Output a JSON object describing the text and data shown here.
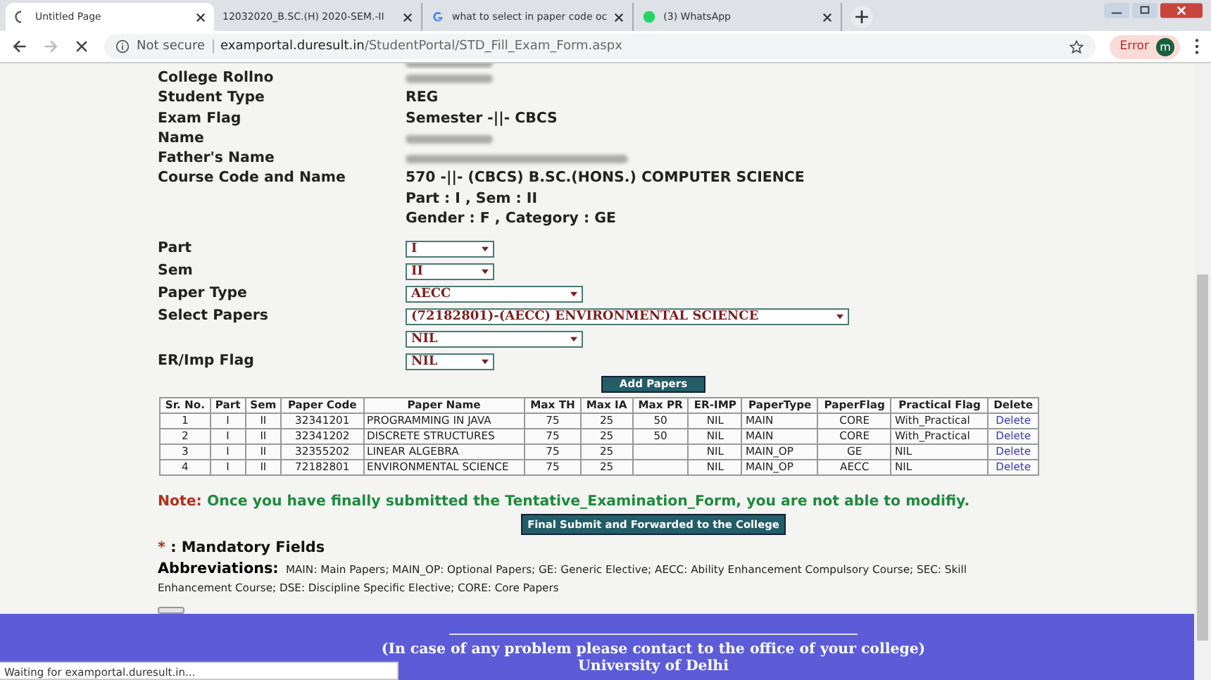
{
  "browser": {
    "tabs": [
      {
        "title": "Untitled Page",
        "kind": "loading",
        "selected": true
      },
      {
        "title": "12032020_B.SC.(H) 2020-SEM.-II",
        "kind": "plain",
        "selected": false
      },
      {
        "title": "what to select in paper code oc",
        "kind": "google",
        "selected": false
      },
      {
        "title": "(3) WhatsApp",
        "kind": "whatsapp",
        "selected": false
      }
    ],
    "security": "Not secure",
    "url_host": "examportal.duresult.in",
    "url_path": "/StudentPortal/STD_Fill_Exam_Form.aspx",
    "error_label": "Error",
    "profile_initial": "m"
  },
  "details": [
    {
      "label": "College Rollno",
      "kind": "blurred"
    },
    {
      "label": "Student Type",
      "kind": "text",
      "lines": [
        "REG"
      ]
    },
    {
      "label": "Exam Flag",
      "kind": "text",
      "lines": [
        "Semester -||- CBCS"
      ]
    },
    {
      "label": "Name",
      "kind": "blurred"
    },
    {
      "label": "Father's Name",
      "kind": "blurred"
    },
    {
      "label": "Course Code and Name",
      "kind": "text",
      "lines": [
        "570 -||- (CBCS) B.SC.(HONS.) COMPUTER SCIENCE",
        "Part : I , Sem : II",
        "Gender : F , Category : GE"
      ]
    }
  ],
  "selects": [
    {
      "label": "Part",
      "value": "I"
    },
    {
      "label": "Sem",
      "value": "II"
    },
    {
      "label": "Paper Type",
      "value": "AECC"
    },
    {
      "label": "Select Papers",
      "value": "(72182801)-(AECC) ENVIRONMENTAL SCIENCE"
    },
    {
      "value": "NIL"
    },
    {
      "label": "ER/Imp Flag",
      "value": "NIL"
    }
  ],
  "add_button": "Add Papers",
  "table": {
    "columns": [
      "Sr. No.",
      "Part",
      "Sem",
      "Paper Code",
      "Paper Name",
      "Max TH",
      "Max IA",
      "Max PR",
      "ER-IMP",
      "PaperType",
      "PaperFlag",
      "Practical Flag",
      "Delete"
    ],
    "rows": [
      [
        "1",
        "I",
        "II",
        "32341201",
        "PROGRAMMING IN JAVA",
        "75",
        "25",
        "50",
        "NIL",
        "MAIN",
        "CORE",
        "With_Practical",
        "Delete"
      ],
      [
        "2",
        "I",
        "II",
        "32341202",
        "DISCRETE STRUCTURES",
        "75",
        "25",
        "50",
        "NIL",
        "MAIN",
        "CORE",
        "With_Practical",
        "Delete"
      ],
      [
        "3",
        "I",
        "II",
        "32355202",
        "LINEAR ALGEBRA",
        "75",
        "25",
        "",
        "NIL",
        "MAIN_OP",
        "GE",
        "NIL",
        "Delete"
      ],
      [
        "4",
        "I",
        "II",
        "72182801",
        "ENVIRONMENTAL SCIENCE",
        "75",
        "25",
        "",
        "NIL",
        "MAIN_OP",
        "AECC",
        "NIL",
        "Delete"
      ]
    ]
  },
  "note_label": "Note:",
  "note_text": "Once you have finally submitted the Tentative_Examination_Form, you are not able to modifiy.",
  "submit_button": "Final Submit and Forwarded to the College",
  "mandatory_mark": "*",
  "mandatory_text": ": Mandatory Fields",
  "abbreviations_label": "Abbreviations:",
  "abbreviations_text": "MAIN: Main Papers; MAIN_OP: Optional Papers; GE: Generic Elective; AECC: Ability Enhancement Compulsory Course; SEC: Skill Enhancement Course; DSE: Discipline Specific Elective; CORE: Core Papers",
  "footer_lines": [
    "(In case of any problem please contact to the office of your college)",
    "University of Delhi"
  ],
  "status_bubble": "Waiting for examportal.duresult.in..."
}
